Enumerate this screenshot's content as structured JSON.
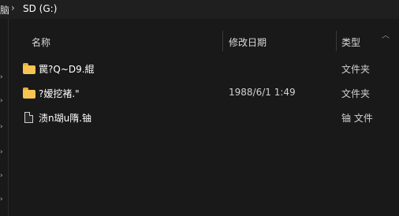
{
  "address": {
    "prev_crumb": "脑",
    "separator": "›",
    "current": "SD (G:)"
  },
  "columns": {
    "name": "名称",
    "date": "修改日期",
    "type": "类型"
  },
  "icons": {
    "sort": "chevron-up-icon",
    "nav": "chevron-right-icon",
    "folder": "folder-icon",
    "file": "file-icon"
  },
  "colors": {
    "background": "#191919",
    "folder": "#f6c453"
  },
  "files": [
    {
      "name": "罠?Q~D9.緄",
      "date": "",
      "type": "文件夹",
      "kind": "folder"
    },
    {
      "name": "?嫒挖褚.\"",
      "date": "1988/6/1 1:49",
      "type": "文件夹",
      "kind": "folder"
    },
    {
      "name": "渍n瑚u隋.铀",
      "date": "",
      "type": "铀 文件",
      "kind": "file"
    }
  ]
}
